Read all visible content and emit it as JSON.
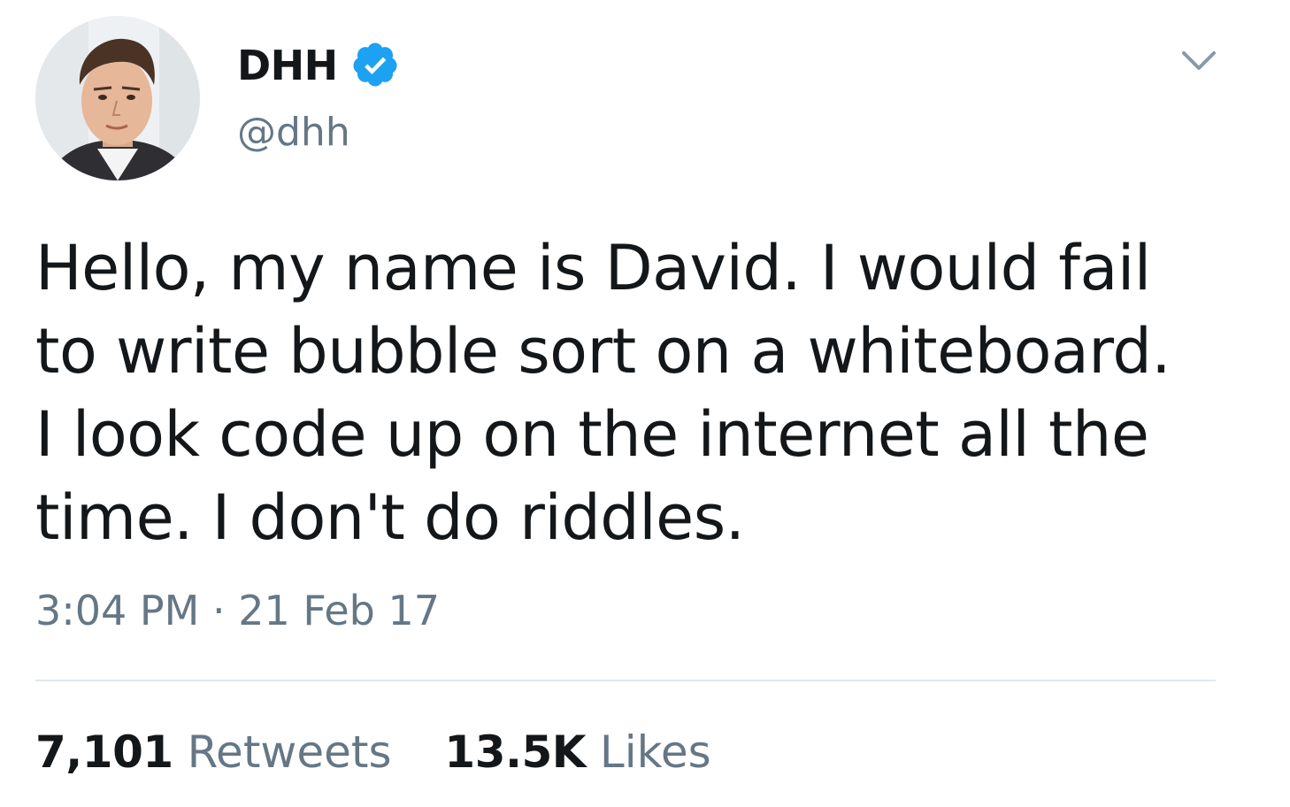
{
  "tweet": {
    "display_name": "DHH",
    "handle": "@dhh",
    "verified": true,
    "text": "Hello, my name is David. I would fail\nto write bubble sort on a whiteboard.\nI look code up on the internet all the\ntime. I don't do riddles.",
    "time": "3:04 PM",
    "separator": "·",
    "date": "21 Feb 17",
    "retweets": {
      "count": "7,101",
      "label": "Retweets"
    },
    "likes": {
      "count": "13.5K",
      "label": "Likes"
    }
  },
  "icons": {
    "verified": "verified-badge-icon",
    "caret": "chevron-down-icon"
  },
  "colors": {
    "text": "#14171a",
    "secondary": "#657786",
    "verified_blue": "#1da1f2",
    "divider": "#e1e8ed"
  }
}
